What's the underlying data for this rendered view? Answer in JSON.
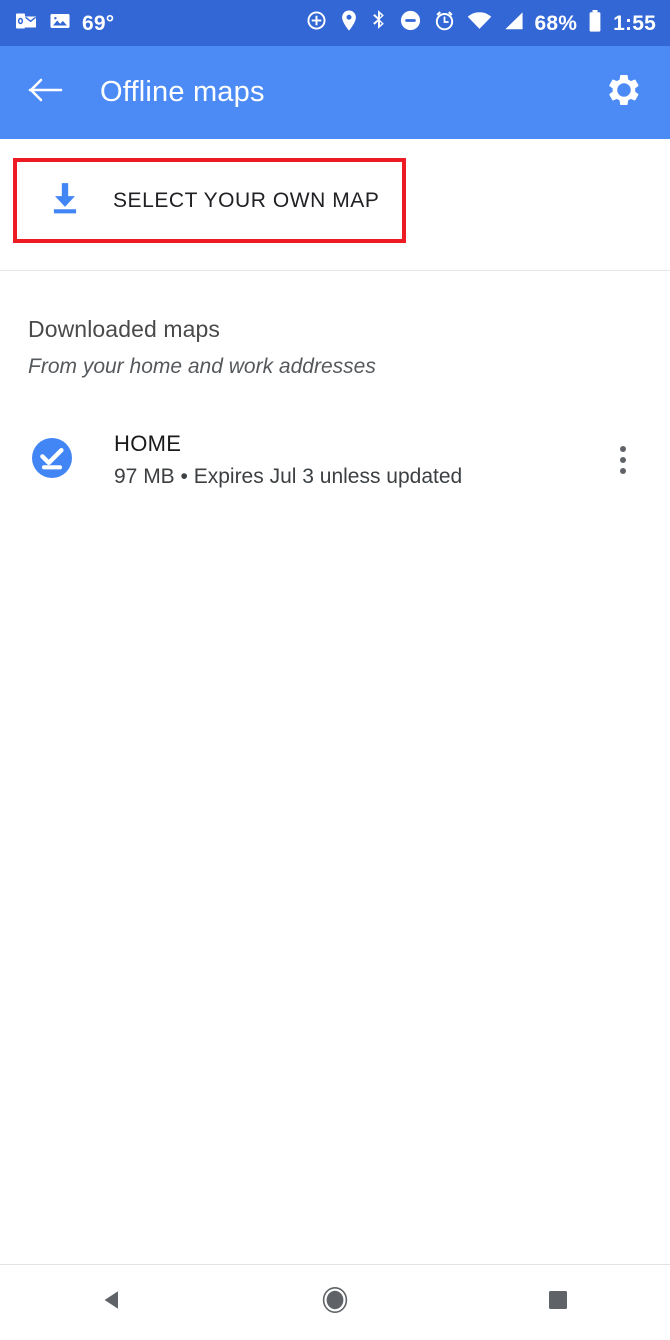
{
  "status_bar": {
    "background": "#3367D6",
    "left_icons": [
      {
        "name": "outlook-icon",
        "label": "Outlook"
      },
      {
        "name": "photos-icon",
        "label": "Photos"
      }
    ],
    "temperature": "69°",
    "right_icons": [
      {
        "name": "cast-add-icon",
        "label": "Cast"
      },
      {
        "name": "location-pin-icon",
        "label": "Location"
      },
      {
        "name": "bluetooth-icon",
        "label": "Bluetooth"
      },
      {
        "name": "do-not-disturb-icon",
        "label": "Do not disturb"
      },
      {
        "name": "alarm-icon",
        "label": "Alarm"
      },
      {
        "name": "wifi-icon",
        "label": "Wi-Fi"
      },
      {
        "name": "cellular-signal-icon",
        "label": "Signal"
      }
    ],
    "battery_percent": "68%",
    "battery_icon": "battery-icon",
    "clock": "1:55"
  },
  "app_bar": {
    "background": "#4C8BF5",
    "back_icon": "back-arrow-icon",
    "title": "Offline maps",
    "settings_icon": "gear-icon"
  },
  "select_map": {
    "icon": "download-icon",
    "icon_color": "#4285F4",
    "label": "SELECT YOUR OWN MAP",
    "highlight_color": "#ED1C24"
  },
  "downloaded": {
    "heading": "Downloaded maps",
    "subheading": "From your home and work addresses",
    "items": [
      {
        "icon": "download-done-icon",
        "icon_color": "#4285F4",
        "name": "HOME",
        "meta": "97 MB • Expires Jul 3 unless updated",
        "overflow_icon": "more-vertical-icon"
      }
    ]
  },
  "nav_bar": {
    "back": "nav-back-icon",
    "home": "nav-home-icon",
    "recents": "nav-recents-icon"
  }
}
